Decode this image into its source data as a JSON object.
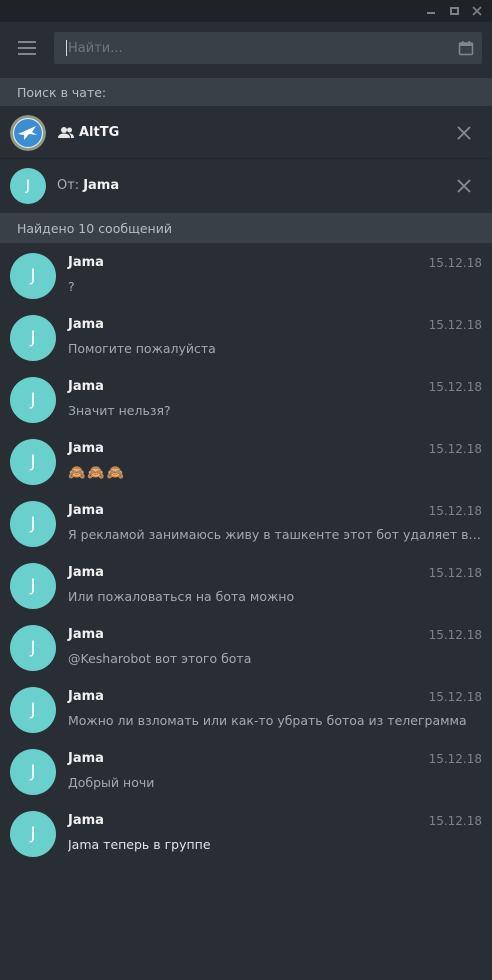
{
  "window_controls": [
    "minimize",
    "maximize",
    "close"
  ],
  "search": {
    "value": "",
    "placeholder": "Найти..."
  },
  "search_in_chat": {
    "label": "Поиск в чате:"
  },
  "chat_filter": {
    "icon": "group-icon",
    "name": "AltTG"
  },
  "from_filter": {
    "avatar_letter": "J",
    "prefix": "От:",
    "name": "Jama"
  },
  "results": {
    "label": "Найдено 10 сообщений",
    "items": [
      {
        "avatar_letter": "J",
        "name": "Jama",
        "date": "15.12.18",
        "text": "?"
      },
      {
        "avatar_letter": "J",
        "name": "Jama",
        "date": "15.12.18",
        "text": "Помогите пожалуйста"
      },
      {
        "avatar_letter": "J",
        "name": "Jama",
        "date": "15.12.18",
        "text": "Значит нельзя?"
      },
      {
        "avatar_letter": "J",
        "name": "Jama",
        "date": "15.12.18",
        "text": "🙈🙈🙈"
      },
      {
        "avatar_letter": "J",
        "name": "Jama",
        "date": "15.12.18",
        "text": "Я рекламой занимаюсь живу в ташкенте этот бот удаляет все линки"
      },
      {
        "avatar_letter": "J",
        "name": "Jama",
        "date": "15.12.18",
        "text": "Или пожаловаться на бота можно"
      },
      {
        "avatar_letter": "J",
        "name": "Jama",
        "date": "15.12.18",
        "text": "@Kesharobot вот этого бота"
      },
      {
        "avatar_letter": "J",
        "name": "Jama",
        "date": "15.12.18",
        "text": "Можно ли взломать или как-то убрать ботоа из телеграмма"
      },
      {
        "avatar_letter": "J",
        "name": "Jama",
        "date": "15.12.18",
        "text": "Добрый ночи"
      },
      {
        "avatar_letter": "J",
        "name": "Jama",
        "date": "15.12.18",
        "text": "Jama теперь в группе"
      }
    ]
  },
  "colors": {
    "background": "#282e33",
    "section_bar": "#3a4047",
    "avatar": "#6ad0cd",
    "muted_text": "#a3a9ae"
  }
}
